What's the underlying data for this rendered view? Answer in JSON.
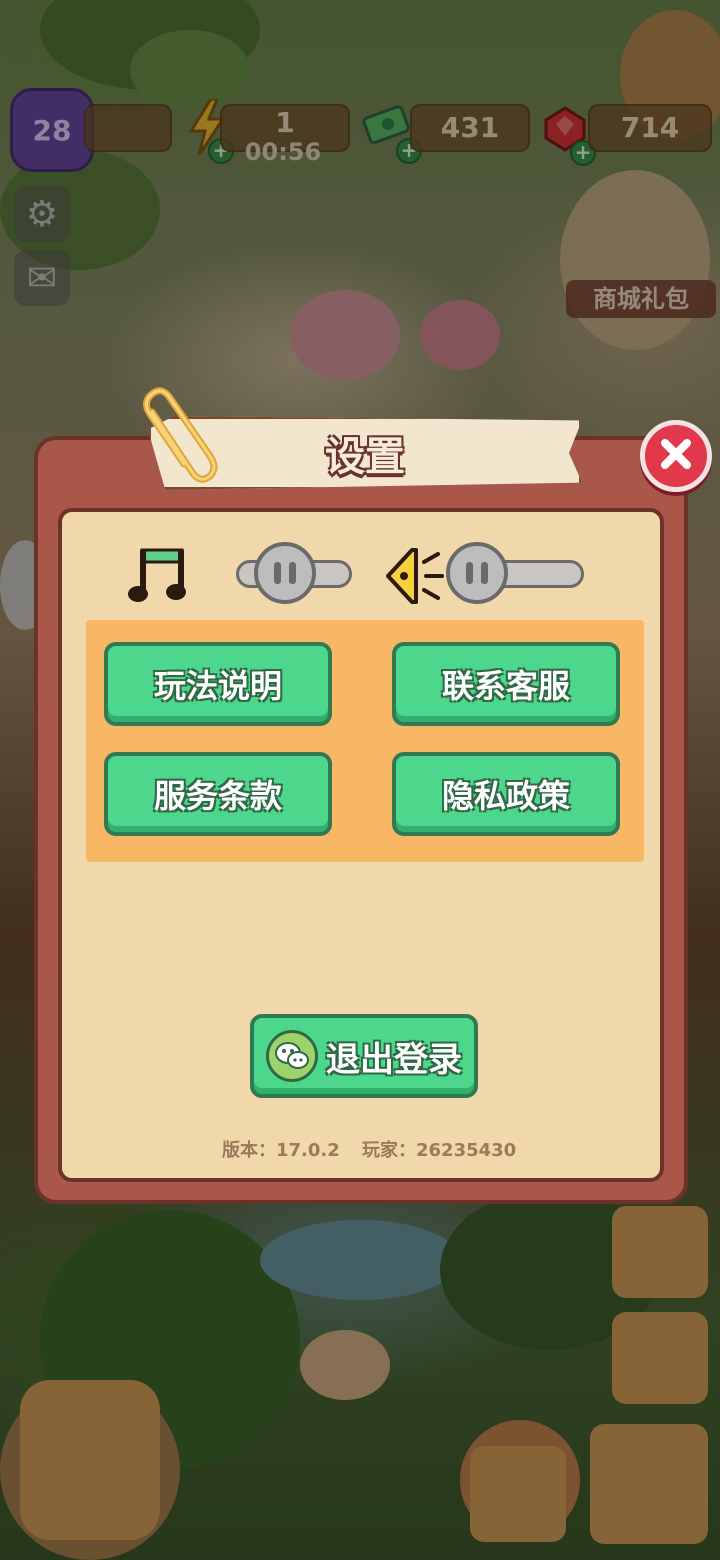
{
  "hud": {
    "level": "28",
    "energy": "1",
    "energy_timer": "00:56",
    "cash": "431",
    "gems": "714",
    "mall_label": "商城礼包"
  },
  "settings": {
    "title": "设置",
    "music_on": false,
    "sound_on": false,
    "buttons": {
      "how_to_play": "玩法说明",
      "contact_support": "联系客服",
      "terms_of_service": "服务条款",
      "privacy_policy": "隐私政策"
    },
    "logout": "退出登录",
    "version_label": "版本：17.0.2",
    "player_label": "玩家：26235430"
  },
  "colors": {
    "dialog_frame": "#a8574a",
    "panel": "#f0d8aa",
    "button_green": "#4cd78c",
    "close_red": "#e2384c"
  }
}
